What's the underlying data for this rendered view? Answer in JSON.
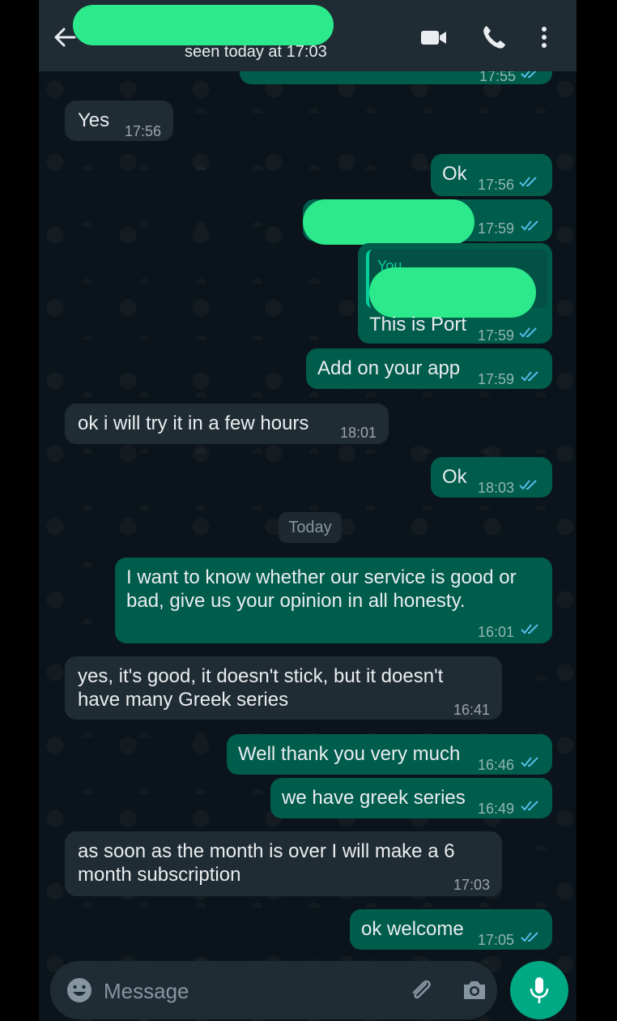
{
  "header": {
    "last_seen": "seen today at 17:03",
    "icons": [
      "back-arrow-icon",
      "video-call-icon",
      "phone-icon",
      "more-vert-icon"
    ]
  },
  "partial_top": {
    "time": "17:55"
  },
  "date_divider": "Today",
  "messages": [
    {
      "dir": "in",
      "text": "Yes",
      "time": "17:56"
    },
    {
      "dir": "out",
      "text": "Ok",
      "time": "17:56",
      "status": "read"
    },
    {
      "dir": "out",
      "text": "",
      "time": "17:59",
      "status": "read",
      "redacted": true
    },
    {
      "dir": "out",
      "quote_label": "You",
      "text": "This is Port",
      "time": "17:59",
      "status": "read"
    },
    {
      "dir": "out",
      "text": "Add on your app",
      "time": "17:59",
      "status": "read"
    },
    {
      "dir": "in",
      "text": "ok i will try it in a few hours",
      "time": "18:01"
    },
    {
      "dir": "out",
      "text": "Ok",
      "time": "18:03",
      "status": "read"
    },
    {
      "dir": "out",
      "lines": [
        "I want to know whether our service is good or",
        "bad, give us your opinion in all honesty."
      ],
      "time": "16:01",
      "status": "read"
    },
    {
      "dir": "in",
      "lines": [
        "yes, it's good, it doesn't stick, but it doesn't",
        "have many Greek series"
      ],
      "time": "16:41"
    },
    {
      "dir": "out",
      "text": "Well thank you very much",
      "time": "16:46",
      "status": "read"
    },
    {
      "dir": "out",
      "text": "we have greek series",
      "time": "16:49",
      "status": "read"
    },
    {
      "dir": "in",
      "lines": [
        "as soon as the month is over I will make a 6",
        "month subscription"
      ],
      "time": "17:03"
    },
    {
      "dir": "out",
      "text": "ok welcome",
      "time": "17:05",
      "status": "read"
    }
  ],
  "composer": {
    "placeholder": "Message"
  },
  "colors": {
    "incoming": "#202c33",
    "outgoing": "#005c4b",
    "accent": "#00a884",
    "read_ticks": "#53bdeb",
    "redaction": "#2ce98c"
  }
}
